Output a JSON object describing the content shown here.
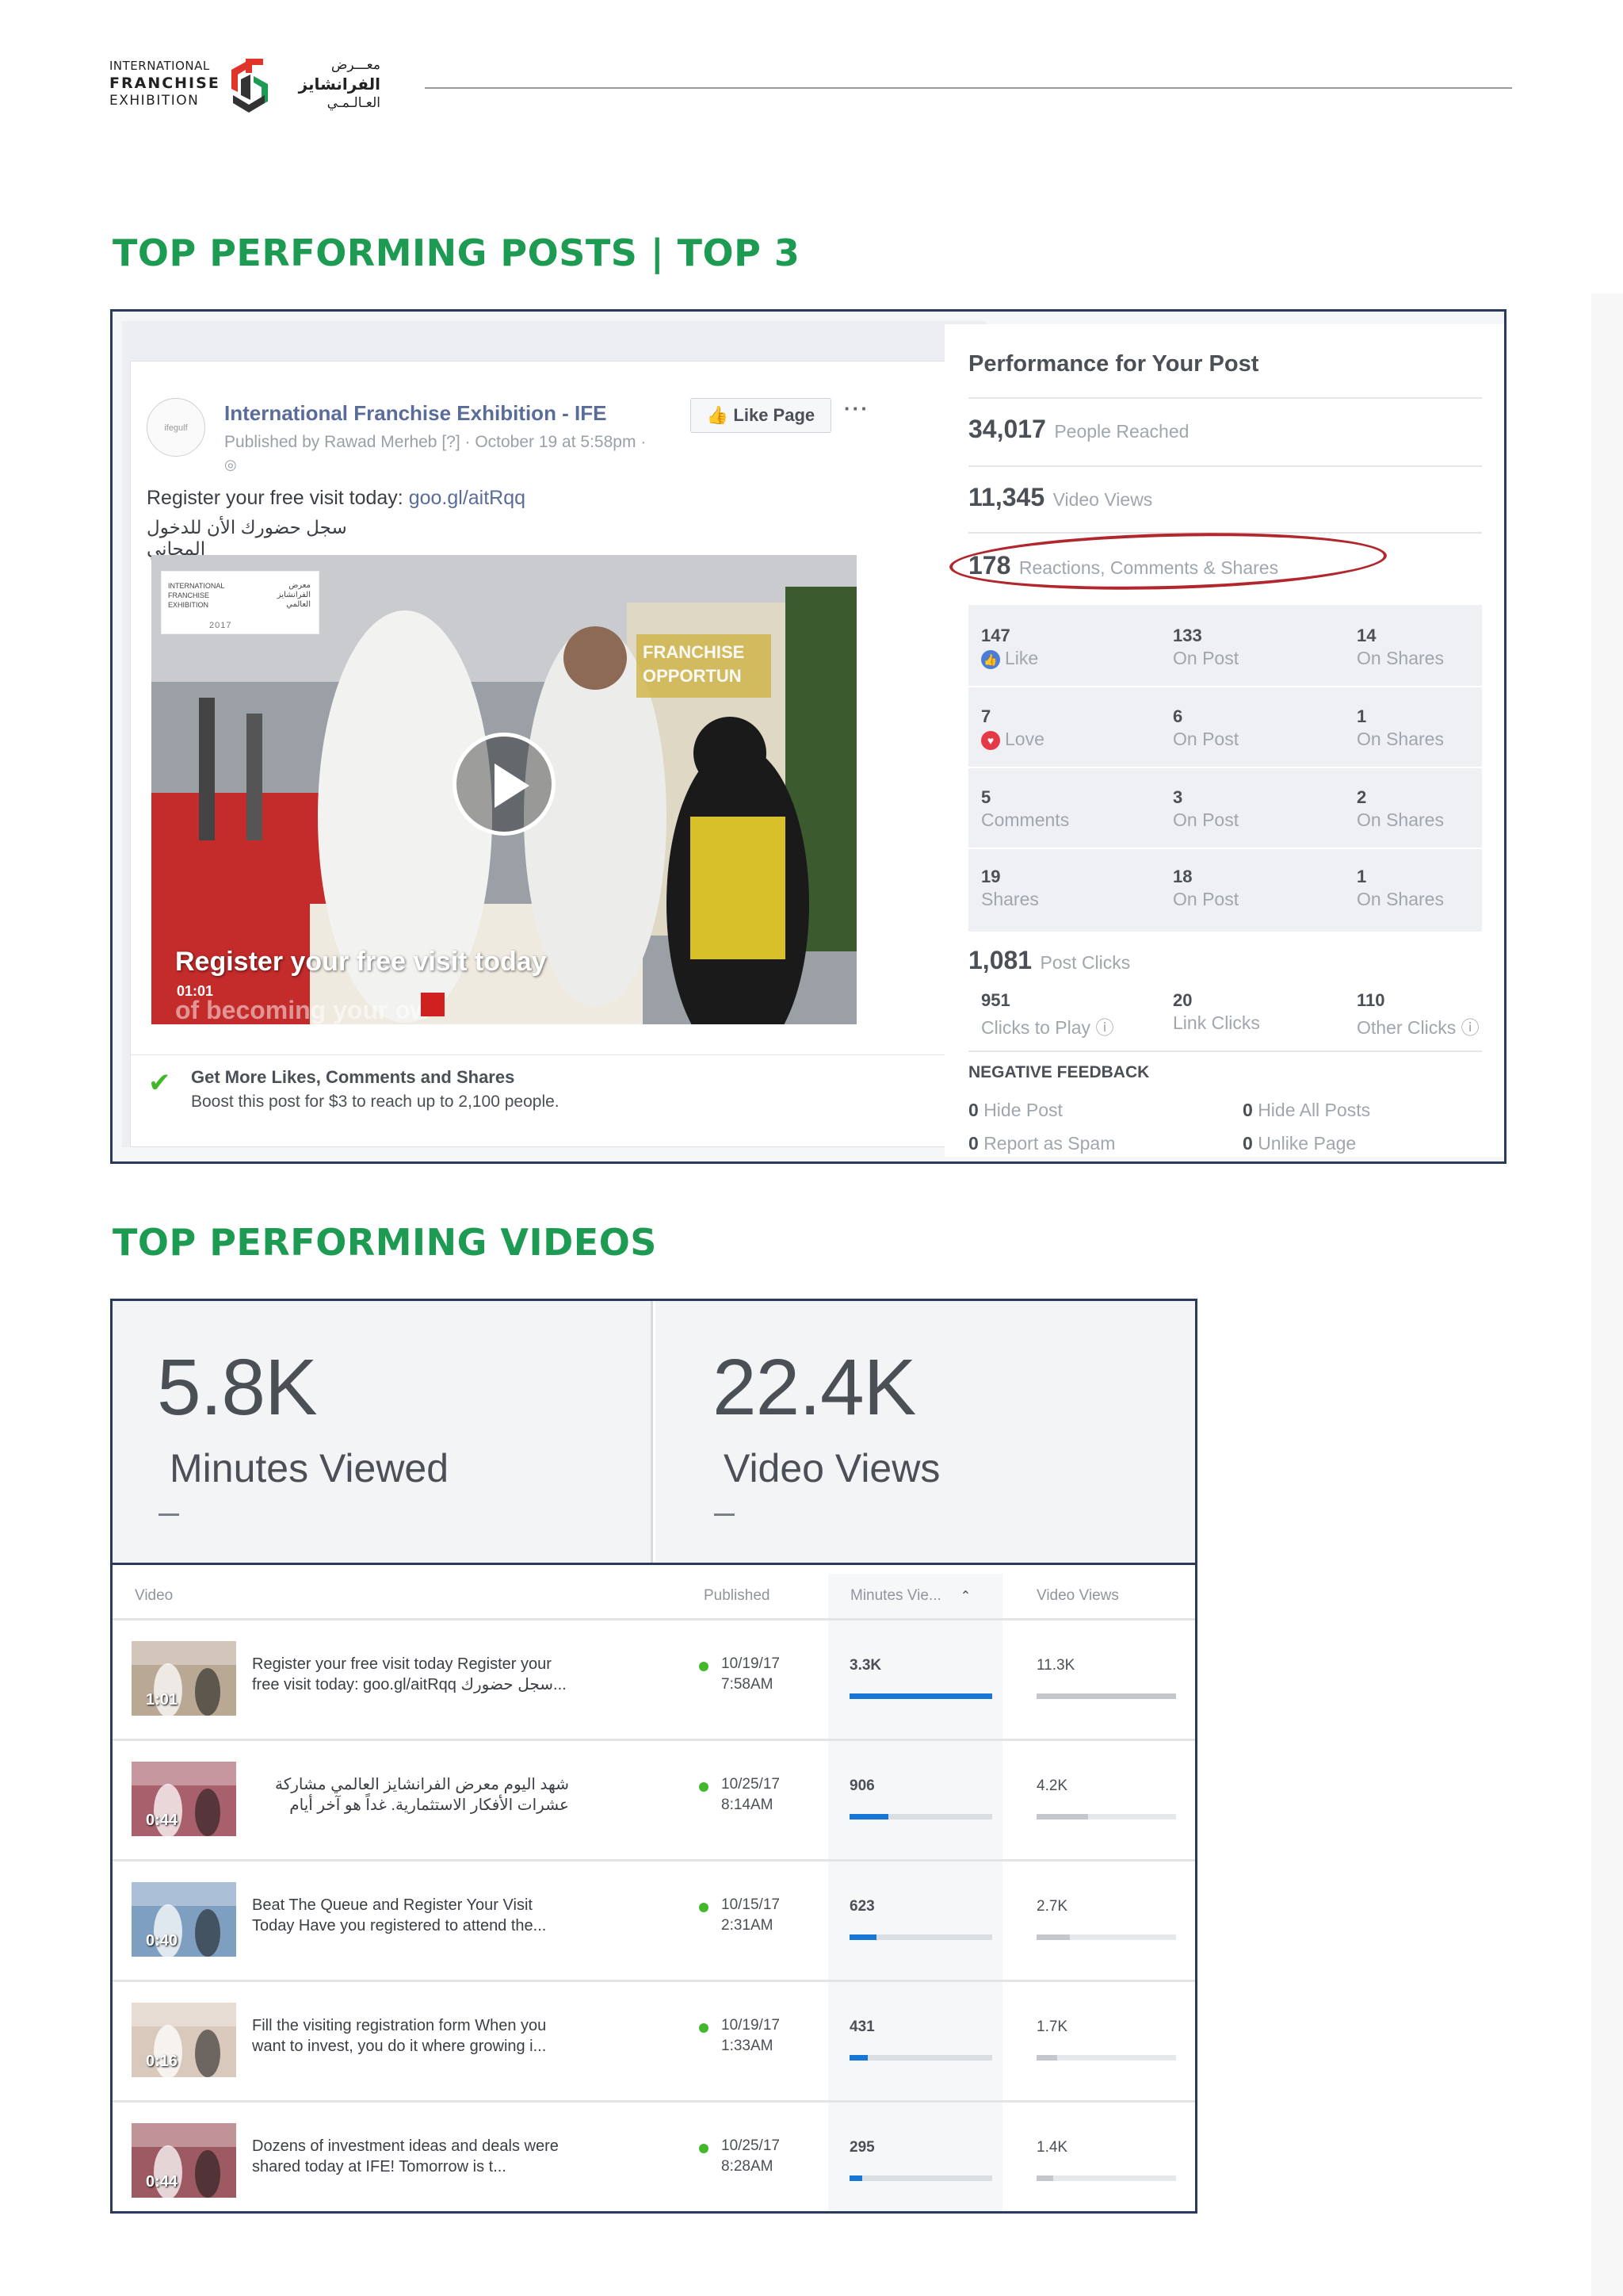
{
  "header": {
    "logo_en": [
      "INTERNATIONAL",
      "FRANCHISE",
      "EXHIBITION"
    ],
    "logo_ar": [
      "معـــرض",
      "الفرانشايز",
      "العـالـمـي"
    ],
    "colors": {
      "brand_green": "#1e9b53",
      "frame_navy": "#2b3a5c"
    }
  },
  "section1": {
    "title": "TOP PERFORMING POSTS | TOP 3"
  },
  "post": {
    "avatar_text": "ifegulf",
    "page_name": "International Franchise Exhibition - IFE",
    "meta": "Published by Rawad Merheb [?] · October 19 at 5:58pm ·",
    "globe_icon": "globe-icon",
    "like_page_label": "Like Page",
    "more_icon": "more-icon",
    "more_glyph": "···",
    "text": "Register your free visit today: ",
    "link": "goo.gl/aitRqq",
    "text_ar": "سجل حضورك الأن للدخول المجاني",
    "video": {
      "logo_en": "INTERNATIONAL\nFRANCHISE\nEXHIBITION",
      "logo_ar": "معرض\nالفرانشايز\nالعالمي",
      "logo_year": "2017",
      "sign_text": "FRANCHISE\nOPPORTUN",
      "caption": "Register your free visit today",
      "time": "01:01",
      "ghost_text": "of becoming your ow"
    },
    "boost_check_icon": "checkmark-icon",
    "boost_title": "Get More Likes, Comments and Shares",
    "boost_sub": "Boost this post for $3 to reach up to 2,100 people."
  },
  "performance": {
    "title": "Performance for Your Post",
    "reached_value": "34,017",
    "reached_label": "People Reached",
    "views_value": "11,345",
    "views_label": "Video Views",
    "reactions_value": "178",
    "reactions_label": "Reactions, Comments & Shares",
    "reactions": [
      {
        "total": "147",
        "label": "Like",
        "icon": "like-icon",
        "on_post": "133",
        "on_post_label": "On Post",
        "on_shares": "14",
        "on_shares_label": "On Shares"
      },
      {
        "total": "7",
        "label": "Love",
        "icon": "love-icon",
        "on_post": "6",
        "on_post_label": "On Post",
        "on_shares": "1",
        "on_shares_label": "On Shares"
      },
      {
        "total": "5",
        "label": "Comments",
        "icon": "",
        "on_post": "3",
        "on_post_label": "On Post",
        "on_shares": "2",
        "on_shares_label": "On Shares"
      },
      {
        "total": "19",
        "label": "Shares",
        "icon": "",
        "on_post": "18",
        "on_post_label": "On Post",
        "on_shares": "1",
        "on_shares_label": "On Shares"
      }
    ],
    "post_clicks_value": "1,081",
    "post_clicks_label": "Post Clicks",
    "clicks": [
      {
        "value": "951",
        "label": "Clicks to Play"
      },
      {
        "value": "20",
        "label": "Link Clicks"
      },
      {
        "value": "110",
        "label": "Other Clicks"
      }
    ],
    "negative_title": "NEGATIVE FEEDBACK",
    "negative": [
      {
        "value": "0",
        "label": "Hide Post"
      },
      {
        "value": "0",
        "label": "Hide All Posts"
      },
      {
        "value": "0",
        "label": "Report as Spam"
      },
      {
        "value": "0",
        "label": "Unlike Page"
      }
    ]
  },
  "section2": {
    "title": "TOP PERFORMING VIDEOS"
  },
  "video_stats": {
    "minutes_viewed_value": "5.8K",
    "minutes_viewed_label": "Minutes Viewed",
    "video_views_value": "22.4K",
    "video_views_label": "Video Views",
    "columns": {
      "video": "Video",
      "published": "Published",
      "minutes": "Minutes Vie...",
      "views": "Video Views"
    },
    "sort_icon": "chevron-up-icon",
    "sort_glyph": "⌃",
    "bar_colors": {
      "minutes": "#1877d6",
      "views": "#c4c7cc"
    },
    "rows": [
      {
        "duration": "1:01",
        "title": "Register your free visit today Register your free visit today: goo.gl/aitRqq سجل حضورك...",
        "rtl": false,
        "date": "10/19/17",
        "time": "7:58AM",
        "minutes": "3.3K",
        "minutes_fraction": 1.0,
        "views": "11.3K",
        "views_fraction": 1.0,
        "thumb_color": "#b9a894"
      },
      {
        "duration": "0:44",
        "title": "شهد اليوم معرض الفرانشايز العالمي مشاركة عشرات الأفكار الاستثمارية. غداً هو آخر أيام المعرض، لا تفوت...",
        "rtl": true,
        "date": "10/25/17",
        "time": "8:14AM",
        "minutes": "906",
        "minutes_fraction": 0.27,
        "views": "4.2K",
        "views_fraction": 0.37,
        "thumb_color": "#a8606c"
      },
      {
        "duration": "0:40",
        "title": "Beat The Queue and Register Your Visit Today Have you registered to attend the...",
        "rtl": false,
        "date": "10/15/17",
        "time": "2:31AM",
        "minutes": "623",
        "minutes_fraction": 0.19,
        "views": "2.7K",
        "views_fraction": 0.24,
        "thumb_color": "#7f9fc0"
      },
      {
        "duration": "0:16",
        "title": "Fill the visiting registration form When you want to invest, you do it where growing i...",
        "rtl": false,
        "date": "10/19/17",
        "time": "1:33AM",
        "minutes": "431",
        "minutes_fraction": 0.13,
        "views": "1.7K",
        "views_fraction": 0.15,
        "thumb_color": "#d9c9bd"
      },
      {
        "duration": "0:44",
        "title": "Dozens of investment ideas and deals were shared today at IFE! Tomorrow is t...",
        "rtl": false,
        "date": "10/25/17",
        "time": "8:28AM",
        "minutes": "295",
        "minutes_fraction": 0.09,
        "views": "1.4K",
        "views_fraction": 0.12,
        "thumb_color": "#9d5a62"
      }
    ]
  }
}
